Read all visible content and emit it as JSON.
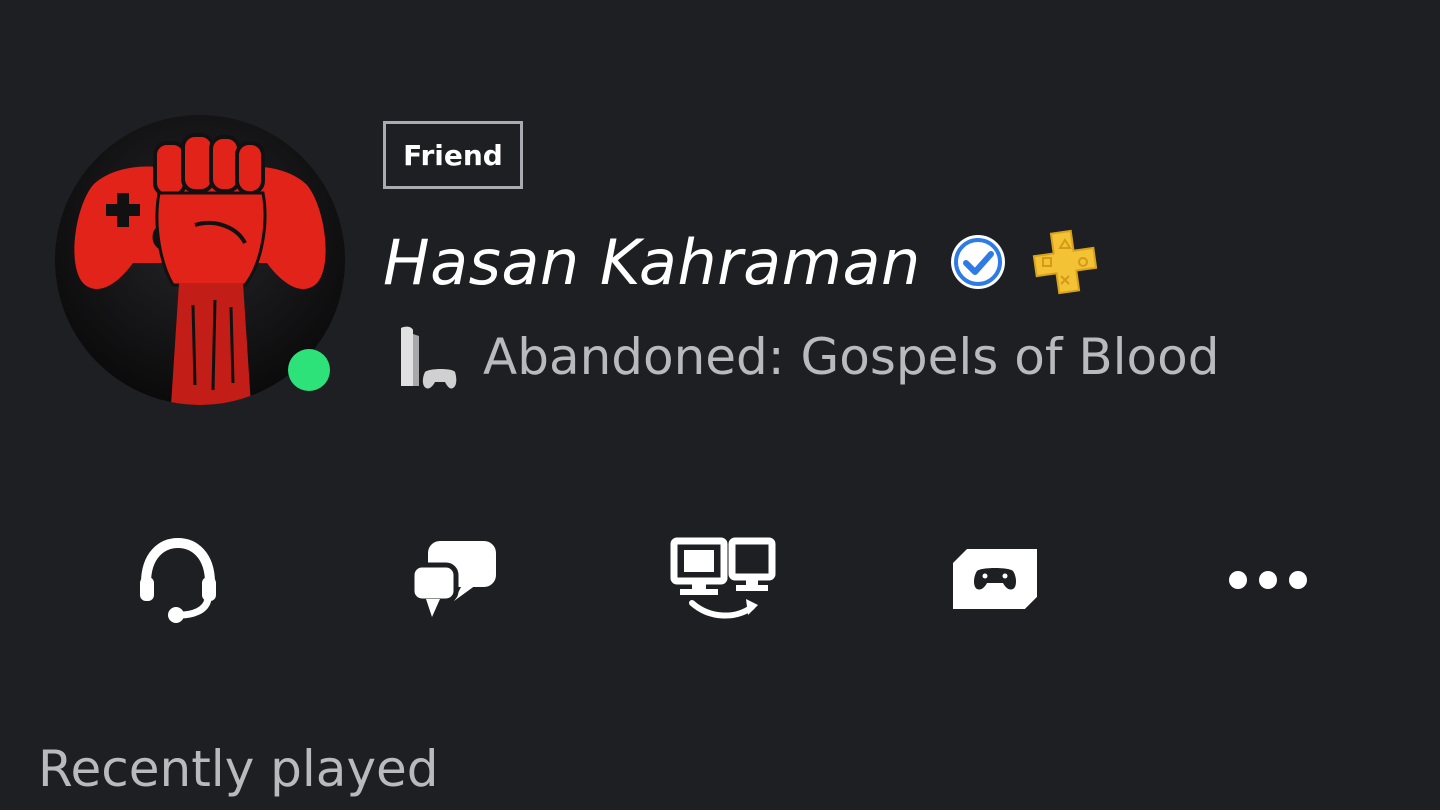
{
  "profile": {
    "relationship_badge": "Friend",
    "name": "Hasan Kahraman",
    "verified": true,
    "ps_plus": true,
    "online_status": "online",
    "avatar_icon": "red-fist-controller-avatar",
    "now_playing": {
      "platform_icon": "ps5-console-icon",
      "game": "Abandoned: Gospels of Blood"
    }
  },
  "actions": [
    {
      "name": "voice-chat-button",
      "icon": "headset-icon"
    },
    {
      "name": "message-button",
      "icon": "chat-bubbles-icon"
    },
    {
      "name": "share-screen-button",
      "icon": "screen-share-icon"
    },
    {
      "name": "share-play-button",
      "icon": "controller-screen-icon"
    },
    {
      "name": "more-options-button",
      "icon": "ellipsis-icon"
    }
  ],
  "sections": {
    "recently_played": "Recently played"
  },
  "colors": {
    "background": "#1e1f23",
    "online": "#2ee27a",
    "verified_blue": "#2f7be6",
    "ps_plus_gold": "#f3c235",
    "avatar_red": "#e2231a"
  }
}
